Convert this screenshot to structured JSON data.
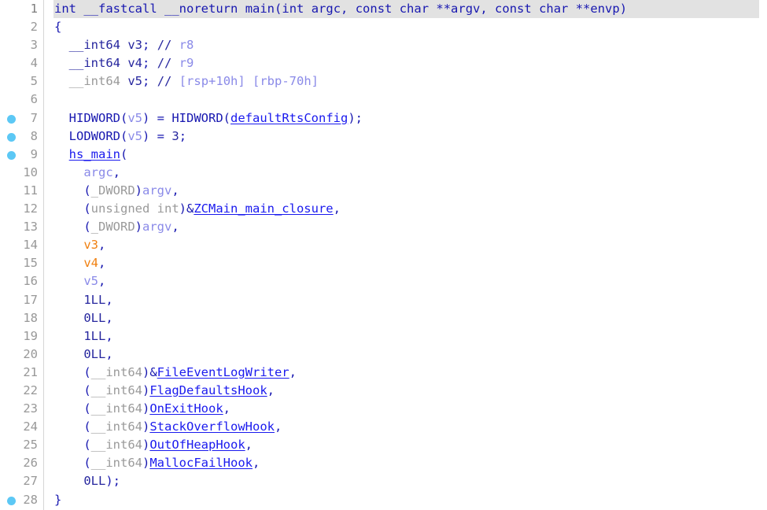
{
  "view": {
    "name": "hex-rays-pseudocode",
    "background": "#ffffff",
    "highlight_color": "#e2e2e2",
    "breakpoint_color": "#5cc8f5",
    "gutter_rule_color": "#d6d6d6",
    "lineno_color": "#989898",
    "total_lines": 28,
    "current_line": 1
  },
  "palette": {
    "punctuation": "#1818b0",
    "type_grey": "#9a9a9a",
    "type_dark": "#26269e",
    "number": "#26269e",
    "local_var": "#8a8ae8",
    "register_var": "#f08010",
    "global_symbol": "#1a1aee",
    "function_name": "#1a1aee",
    "comment": "#8a8ae8"
  },
  "lines": [
    {
      "number": "1",
      "breakpoint": false,
      "highlighted": true,
      "tokens": [
        {
          "t": "int",
          "c": "t-kw"
        },
        {
          "t": " ",
          "c": "t-plain"
        },
        {
          "t": "__fastcall",
          "c": "t-kw"
        },
        {
          "t": " ",
          "c": "t-plain"
        },
        {
          "t": "__noreturn",
          "c": "t-kw"
        },
        {
          "t": " ",
          "c": "t-plain"
        },
        {
          "t": "main",
          "c": "t-kw"
        },
        {
          "t": "(",
          "c": "t-plain"
        },
        {
          "t": "int",
          "c": "t-kw"
        },
        {
          "t": " ",
          "c": "t-plain"
        },
        {
          "t": "argc",
          "c": "t-kw"
        },
        {
          "t": ", ",
          "c": "t-plain"
        },
        {
          "t": "const",
          "c": "t-kw"
        },
        {
          "t": " ",
          "c": "t-plain"
        },
        {
          "t": "char",
          "c": "t-kw"
        },
        {
          "t": " **",
          "c": "t-plain"
        },
        {
          "t": "argv",
          "c": "t-kw"
        },
        {
          "t": ", ",
          "c": "t-plain"
        },
        {
          "t": "const",
          "c": "t-kw"
        },
        {
          "t": " ",
          "c": "t-plain"
        },
        {
          "t": "char",
          "c": "t-kw"
        },
        {
          "t": " **",
          "c": "t-plain"
        },
        {
          "t": "envp",
          "c": "t-kw"
        },
        {
          "t": ")",
          "c": "t-plain"
        }
      ]
    },
    {
      "number": "2",
      "breakpoint": false,
      "highlighted": false,
      "tokens": [
        {
          "t": "{",
          "c": "t-plain"
        }
      ]
    },
    {
      "number": "3",
      "breakpoint": false,
      "highlighted": false,
      "tokens": [
        {
          "t": "  ",
          "c": "t-plain"
        },
        {
          "t": "__int64",
          "c": "t-typedk"
        },
        {
          "t": " ",
          "c": "t-plain"
        },
        {
          "t": "v3",
          "c": "t-typedk"
        },
        {
          "t": "; ",
          "c": "t-plain"
        },
        {
          "t": "//",
          "c": "t-cmtmark"
        },
        {
          "t": " ",
          "c": "t-plain"
        },
        {
          "t": "r8",
          "c": "t-comment"
        }
      ]
    },
    {
      "number": "4",
      "breakpoint": false,
      "highlighted": false,
      "tokens": [
        {
          "t": "  ",
          "c": "t-plain"
        },
        {
          "t": "__int64",
          "c": "t-typedk"
        },
        {
          "t": " ",
          "c": "t-plain"
        },
        {
          "t": "v4",
          "c": "t-typedk"
        },
        {
          "t": "; ",
          "c": "t-plain"
        },
        {
          "t": "//",
          "c": "t-cmtmark"
        },
        {
          "t": " ",
          "c": "t-plain"
        },
        {
          "t": "r9",
          "c": "t-comment"
        }
      ]
    },
    {
      "number": "5",
      "breakpoint": false,
      "highlighted": false,
      "tokens": [
        {
          "t": "  ",
          "c": "t-plain"
        },
        {
          "t": "__int64",
          "c": "t-type"
        },
        {
          "t": " ",
          "c": "t-plain"
        },
        {
          "t": "v5",
          "c": "t-typedk"
        },
        {
          "t": "; ",
          "c": "t-plain"
        },
        {
          "t": "//",
          "c": "t-cmtmark"
        },
        {
          "t": " ",
          "c": "t-plain"
        },
        {
          "t": "[rsp+10h] [rbp-70h]",
          "c": "t-comment"
        }
      ]
    },
    {
      "number": "6",
      "breakpoint": false,
      "highlighted": false,
      "tokens": []
    },
    {
      "number": "7",
      "breakpoint": true,
      "highlighted": false,
      "tokens": [
        {
          "t": "  ",
          "c": "t-plain"
        },
        {
          "t": "HIDWORD",
          "c": "t-kw"
        },
        {
          "t": "(",
          "c": "t-plain"
        },
        {
          "t": "v5",
          "c": "t-var"
        },
        {
          "t": ") = ",
          "c": "t-plain"
        },
        {
          "t": "HIDWORD",
          "c": "t-kw"
        },
        {
          "t": "(",
          "c": "t-plain"
        },
        {
          "t": "defaultRtsConfig",
          "c": "t-glob"
        },
        {
          "t": ");",
          "c": "t-plain"
        }
      ]
    },
    {
      "number": "8",
      "breakpoint": true,
      "highlighted": false,
      "tokens": [
        {
          "t": "  ",
          "c": "t-plain"
        },
        {
          "t": "LODWORD",
          "c": "t-kw"
        },
        {
          "t": "(",
          "c": "t-plain"
        },
        {
          "t": "v5",
          "c": "t-var"
        },
        {
          "t": ") = ",
          "c": "t-plain"
        },
        {
          "t": "3",
          "c": "t-num"
        },
        {
          "t": ";",
          "c": "t-plain"
        }
      ]
    },
    {
      "number": "9",
      "breakpoint": true,
      "highlighted": false,
      "tokens": [
        {
          "t": "  ",
          "c": "t-plain"
        },
        {
          "t": "hs_main",
          "c": "t-func"
        },
        {
          "t": "(",
          "c": "t-plain"
        }
      ]
    },
    {
      "number": "10",
      "breakpoint": false,
      "highlighted": false,
      "tokens": [
        {
          "t": "    ",
          "c": "t-plain"
        },
        {
          "t": "argc",
          "c": "t-var"
        },
        {
          "t": ",",
          "c": "t-plain"
        }
      ]
    },
    {
      "number": "11",
      "breakpoint": false,
      "highlighted": false,
      "tokens": [
        {
          "t": "    ",
          "c": "t-plain"
        },
        {
          "t": "(",
          "c": "t-plain"
        },
        {
          "t": "_DWORD",
          "c": "t-type"
        },
        {
          "t": ")",
          "c": "t-plain"
        },
        {
          "t": "argv",
          "c": "t-var"
        },
        {
          "t": ",",
          "c": "t-plain"
        }
      ]
    },
    {
      "number": "12",
      "breakpoint": false,
      "highlighted": false,
      "tokens": [
        {
          "t": "    ",
          "c": "t-plain"
        },
        {
          "t": "(",
          "c": "t-plain"
        },
        {
          "t": "unsigned int",
          "c": "t-type"
        },
        {
          "t": ")&",
          "c": "t-plain"
        },
        {
          "t": "ZCMain_main_closure",
          "c": "t-glob"
        },
        {
          "t": ",",
          "c": "t-plain"
        }
      ]
    },
    {
      "number": "13",
      "breakpoint": false,
      "highlighted": false,
      "tokens": [
        {
          "t": "    ",
          "c": "t-plain"
        },
        {
          "t": "(",
          "c": "t-plain"
        },
        {
          "t": "_DWORD",
          "c": "t-type"
        },
        {
          "t": ")",
          "c": "t-plain"
        },
        {
          "t": "argv",
          "c": "t-var"
        },
        {
          "t": ",",
          "c": "t-plain"
        }
      ]
    },
    {
      "number": "14",
      "breakpoint": false,
      "highlighted": false,
      "tokens": [
        {
          "t": "    ",
          "c": "t-plain"
        },
        {
          "t": "v3",
          "c": "t-varhot"
        },
        {
          "t": ",",
          "c": "t-plain"
        }
      ]
    },
    {
      "number": "15",
      "breakpoint": false,
      "highlighted": false,
      "tokens": [
        {
          "t": "    ",
          "c": "t-plain"
        },
        {
          "t": "v4",
          "c": "t-varhot"
        },
        {
          "t": ",",
          "c": "t-plain"
        }
      ]
    },
    {
      "number": "16",
      "breakpoint": false,
      "highlighted": false,
      "tokens": [
        {
          "t": "    ",
          "c": "t-plain"
        },
        {
          "t": "v5",
          "c": "t-var"
        },
        {
          "t": ",",
          "c": "t-plain"
        }
      ]
    },
    {
      "number": "17",
      "breakpoint": false,
      "highlighted": false,
      "tokens": [
        {
          "t": "    ",
          "c": "t-plain"
        },
        {
          "t": "1LL",
          "c": "t-num"
        },
        {
          "t": ",",
          "c": "t-plain"
        }
      ]
    },
    {
      "number": "18",
      "breakpoint": false,
      "highlighted": false,
      "tokens": [
        {
          "t": "    ",
          "c": "t-plain"
        },
        {
          "t": "0LL",
          "c": "t-num"
        },
        {
          "t": ",",
          "c": "t-plain"
        }
      ]
    },
    {
      "number": "19",
      "breakpoint": false,
      "highlighted": false,
      "tokens": [
        {
          "t": "    ",
          "c": "t-plain"
        },
        {
          "t": "1LL",
          "c": "t-num"
        },
        {
          "t": ",",
          "c": "t-plain"
        }
      ]
    },
    {
      "number": "20",
      "breakpoint": false,
      "highlighted": false,
      "tokens": [
        {
          "t": "    ",
          "c": "t-plain"
        },
        {
          "t": "0LL",
          "c": "t-num"
        },
        {
          "t": ",",
          "c": "t-plain"
        }
      ]
    },
    {
      "number": "21",
      "breakpoint": false,
      "highlighted": false,
      "tokens": [
        {
          "t": "    ",
          "c": "t-plain"
        },
        {
          "t": "(",
          "c": "t-plain"
        },
        {
          "t": "__int64",
          "c": "t-type"
        },
        {
          "t": ")&",
          "c": "t-plain"
        },
        {
          "t": "FileEventLogWriter",
          "c": "t-glob"
        },
        {
          "t": ",",
          "c": "t-plain"
        }
      ]
    },
    {
      "number": "22",
      "breakpoint": false,
      "highlighted": false,
      "tokens": [
        {
          "t": "    ",
          "c": "t-plain"
        },
        {
          "t": "(",
          "c": "t-plain"
        },
        {
          "t": "__int64",
          "c": "t-type"
        },
        {
          "t": ")",
          "c": "t-plain"
        },
        {
          "t": "FlagDefaultsHook",
          "c": "t-glob"
        },
        {
          "t": ",",
          "c": "t-plain"
        }
      ]
    },
    {
      "number": "23",
      "breakpoint": false,
      "highlighted": false,
      "tokens": [
        {
          "t": "    ",
          "c": "t-plain"
        },
        {
          "t": "(",
          "c": "t-plain"
        },
        {
          "t": "__int64",
          "c": "t-type"
        },
        {
          "t": ")",
          "c": "t-plain"
        },
        {
          "t": "OnExitHook",
          "c": "t-glob"
        },
        {
          "t": ",",
          "c": "t-plain"
        }
      ]
    },
    {
      "number": "24",
      "breakpoint": false,
      "highlighted": false,
      "tokens": [
        {
          "t": "    ",
          "c": "t-plain"
        },
        {
          "t": "(",
          "c": "t-plain"
        },
        {
          "t": "__int64",
          "c": "t-type"
        },
        {
          "t": ")",
          "c": "t-plain"
        },
        {
          "t": "StackOverflowHook",
          "c": "t-glob"
        },
        {
          "t": ",",
          "c": "t-plain"
        }
      ]
    },
    {
      "number": "25",
      "breakpoint": false,
      "highlighted": false,
      "tokens": [
        {
          "t": "    ",
          "c": "t-plain"
        },
        {
          "t": "(",
          "c": "t-plain"
        },
        {
          "t": "__int64",
          "c": "t-type"
        },
        {
          "t": ")",
          "c": "t-plain"
        },
        {
          "t": "OutOfHeapHook",
          "c": "t-glob"
        },
        {
          "t": ",",
          "c": "t-plain"
        }
      ]
    },
    {
      "number": "26",
      "breakpoint": false,
      "highlighted": false,
      "tokens": [
        {
          "t": "    ",
          "c": "t-plain"
        },
        {
          "t": "(",
          "c": "t-plain"
        },
        {
          "t": "__int64",
          "c": "t-type"
        },
        {
          "t": ")",
          "c": "t-plain"
        },
        {
          "t": "MallocFailHook",
          "c": "t-glob"
        },
        {
          "t": ",",
          "c": "t-plain"
        }
      ]
    },
    {
      "number": "27",
      "breakpoint": false,
      "highlighted": false,
      "tokens": [
        {
          "t": "    ",
          "c": "t-plain"
        },
        {
          "t": "0LL",
          "c": "t-num"
        },
        {
          "t": ");",
          "c": "t-plain"
        }
      ]
    },
    {
      "number": "28",
      "breakpoint": true,
      "highlighted": false,
      "tokens": [
        {
          "t": "}",
          "c": "t-plain"
        }
      ]
    }
  ]
}
